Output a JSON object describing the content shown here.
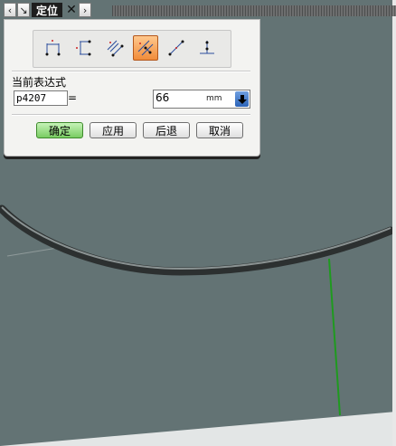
{
  "titlebar": {
    "title": "定位",
    "back_icon": "chevron-left",
    "pin_icon": "pin-arrow",
    "close_icon": "close-x",
    "forward_icon": "chevron-right"
  },
  "dialog": {
    "constraint_tools": [
      {
        "icon": "horizontal-dimension-icon",
        "selected": false
      },
      {
        "icon": "vertical-dimension-icon",
        "selected": false
      },
      {
        "icon": "parallel-dimension-icon",
        "selected": false
      },
      {
        "icon": "perpendicular-dimension-icon",
        "selected": true
      },
      {
        "icon": "point-onto-line-icon",
        "selected": false
      },
      {
        "icon": "point-onto-point-icon",
        "selected": false
      }
    ],
    "expression_label": "当前表达式",
    "expression_name": "p4207",
    "equals_sign": "=",
    "value": "66",
    "unit": "mm",
    "buttons": {
      "ok": "确定",
      "apply": "应用",
      "back": "后退",
      "cancel": "取消"
    }
  },
  "colors": {
    "viewport_background": "#637374",
    "selected_tool": "#f18c3a",
    "ok_button": "#79cc62",
    "model_edge": "#1f9a1f"
  }
}
